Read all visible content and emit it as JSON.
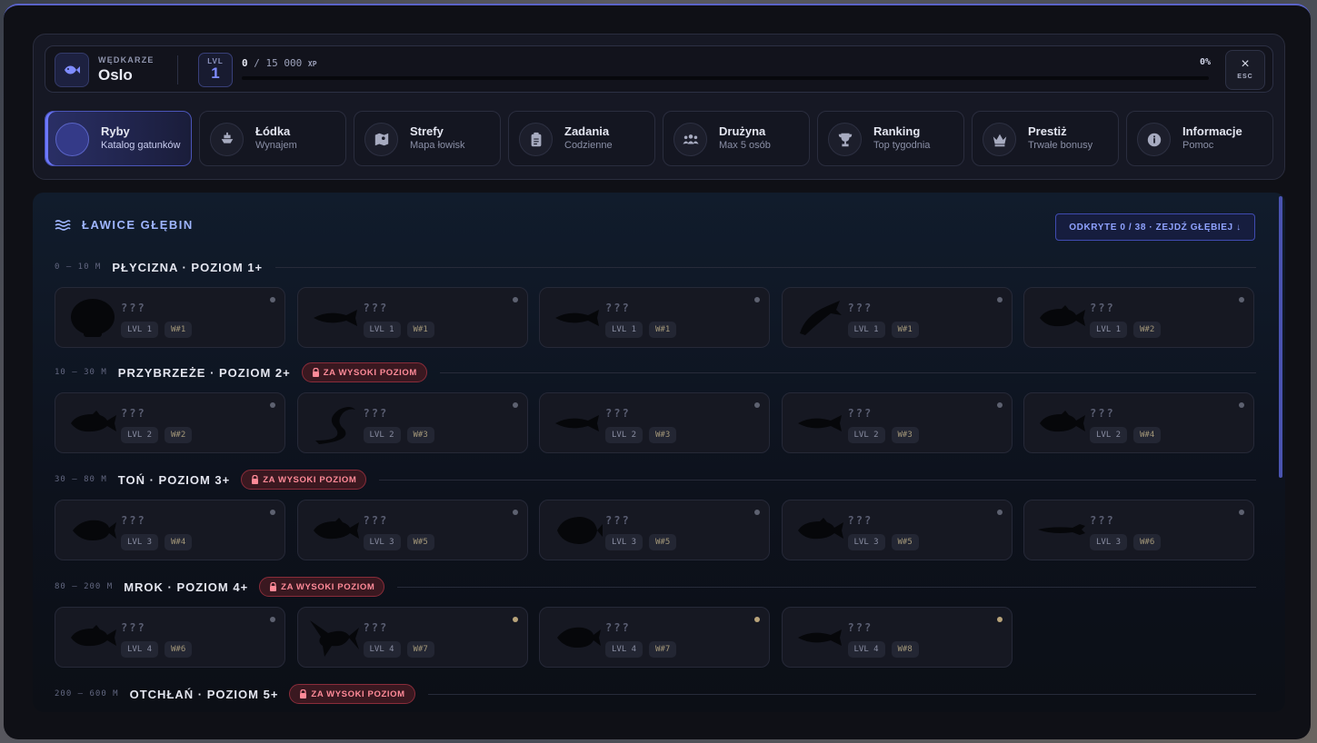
{
  "profile": {
    "role": "WĘDKARZE",
    "name": "Oslo",
    "lvl_label": "LVL",
    "level": "1",
    "xp_current": "0",
    "xp_sep": "/",
    "xp_max": "15 000",
    "xp_unit": "XP",
    "xp_percent": "0%",
    "xp_fraction": 0,
    "close_icon": "×",
    "close_label": "ESC"
  },
  "tabs": [
    {
      "title": "Ryby",
      "sub": "Katalog gatunków",
      "icon": "fish-icon",
      "active": true
    },
    {
      "title": "Łódka",
      "sub": "Wynajem",
      "icon": "boat-icon",
      "active": false
    },
    {
      "title": "Strefy",
      "sub": "Mapa łowisk",
      "icon": "map-icon",
      "active": false
    },
    {
      "title": "Zadania",
      "sub": "Codzienne",
      "icon": "clipboard-icon",
      "active": false
    },
    {
      "title": "Drużyna",
      "sub": "Max 5 osób",
      "icon": "team-icon",
      "active": false
    },
    {
      "title": "Ranking",
      "sub": "Top tygodnia",
      "icon": "trophy-icon",
      "active": false
    },
    {
      "title": "Prestiż",
      "sub": "Trwałe bonusy",
      "icon": "crown-icon",
      "active": false
    },
    {
      "title": "Informacje",
      "sub": "Pomoc",
      "icon": "info-icon",
      "active": false
    }
  ],
  "section": {
    "title": "ŁAWICE GŁĘBIN",
    "discover": "ODKRYTE 0 / 38 · ZEJDŹ GŁĘBIEJ ↓"
  },
  "zones": [
    {
      "depth": "0 – 10 M",
      "name": "PŁYCIZNA · POZIOM 1+",
      "locked": false,
      "lock_label": "",
      "fish": [
        {
          "name": "???",
          "lvl": "LVL 1",
          "loc": "W#1",
          "shape": "shell",
          "dot": "grey"
        },
        {
          "name": "???",
          "lvl": "LVL 1",
          "loc": "W#1",
          "shape": "slim",
          "dot": "grey"
        },
        {
          "name": "???",
          "lvl": "LVL 1",
          "loc": "W#1",
          "shape": "slim",
          "dot": "grey"
        },
        {
          "name": "???",
          "lvl": "LVL 1",
          "loc": "W#1",
          "shape": "jumping",
          "dot": "grey"
        },
        {
          "name": "???",
          "lvl": "LVL 1",
          "loc": "W#2",
          "shape": "perch",
          "dot": "grey"
        }
      ]
    },
    {
      "depth": "10 – 30 M",
      "name": "PRZYBRZEŻE · POZIOM 2+",
      "locked": true,
      "lock_label": "ZA WYSOKI POZIOM",
      "fish": [
        {
          "name": "???",
          "lvl": "LVL 2",
          "loc": "W#2",
          "shape": "perch",
          "dot": "grey"
        },
        {
          "name": "???",
          "lvl": "LVL 2",
          "loc": "W#3",
          "shape": "eel",
          "dot": "grey"
        },
        {
          "name": "???",
          "lvl": "LVL 2",
          "loc": "W#3",
          "shape": "slim",
          "dot": "grey"
        },
        {
          "name": "???",
          "lvl": "LVL 2",
          "loc": "W#3",
          "shape": "slim",
          "dot": "grey"
        },
        {
          "name": "???",
          "lvl": "LVL 2",
          "loc": "W#4",
          "shape": "perch",
          "dot": "grey"
        }
      ]
    },
    {
      "depth": "30 – 80 M",
      "name": "TOŃ · POZIOM 3+",
      "locked": true,
      "lock_label": "ZA WYSOKI POZIOM",
      "fish": [
        {
          "name": "???",
          "lvl": "LVL 3",
          "loc": "W#4",
          "shape": "round",
          "dot": "grey"
        },
        {
          "name": "???",
          "lvl": "LVL 3",
          "loc": "W#5",
          "shape": "perch",
          "dot": "grey"
        },
        {
          "name": "???",
          "lvl": "LVL 3",
          "loc": "W#5",
          "shape": "flat",
          "dot": "grey"
        },
        {
          "name": "???",
          "lvl": "LVL 3",
          "loc": "W#5",
          "shape": "perch",
          "dot": "grey"
        },
        {
          "name": "???",
          "lvl": "LVL 3",
          "loc": "W#6",
          "shape": "pike",
          "dot": "grey"
        }
      ]
    },
    {
      "depth": "80 – 200 M",
      "name": "MROK · POZIOM 4+",
      "locked": true,
      "lock_label": "ZA WYSOKI POZIOM",
      "fish": [
        {
          "name": "???",
          "lvl": "LVL 4",
          "loc": "W#6",
          "shape": "perch",
          "dot": "grey"
        },
        {
          "name": "???",
          "lvl": "LVL 4",
          "loc": "W#7",
          "shape": "marlin",
          "dot": "gold"
        },
        {
          "name": "???",
          "lvl": "LVL 4",
          "loc": "W#7",
          "shape": "round",
          "dot": "gold"
        },
        {
          "name": "???",
          "lvl": "LVL 4",
          "loc": "W#8",
          "shape": "slim",
          "dot": "gold"
        }
      ]
    },
    {
      "depth": "200 – 600 M",
      "name": "OTCHŁAŃ · POZIOM 5+",
      "locked": true,
      "lock_label": "ZA WYSOKI POZIOM",
      "fish": []
    }
  ],
  "colors": {
    "accent": "#6c78ff",
    "lock": "#ff8a98",
    "gold_dot": "#b8a37a"
  }
}
